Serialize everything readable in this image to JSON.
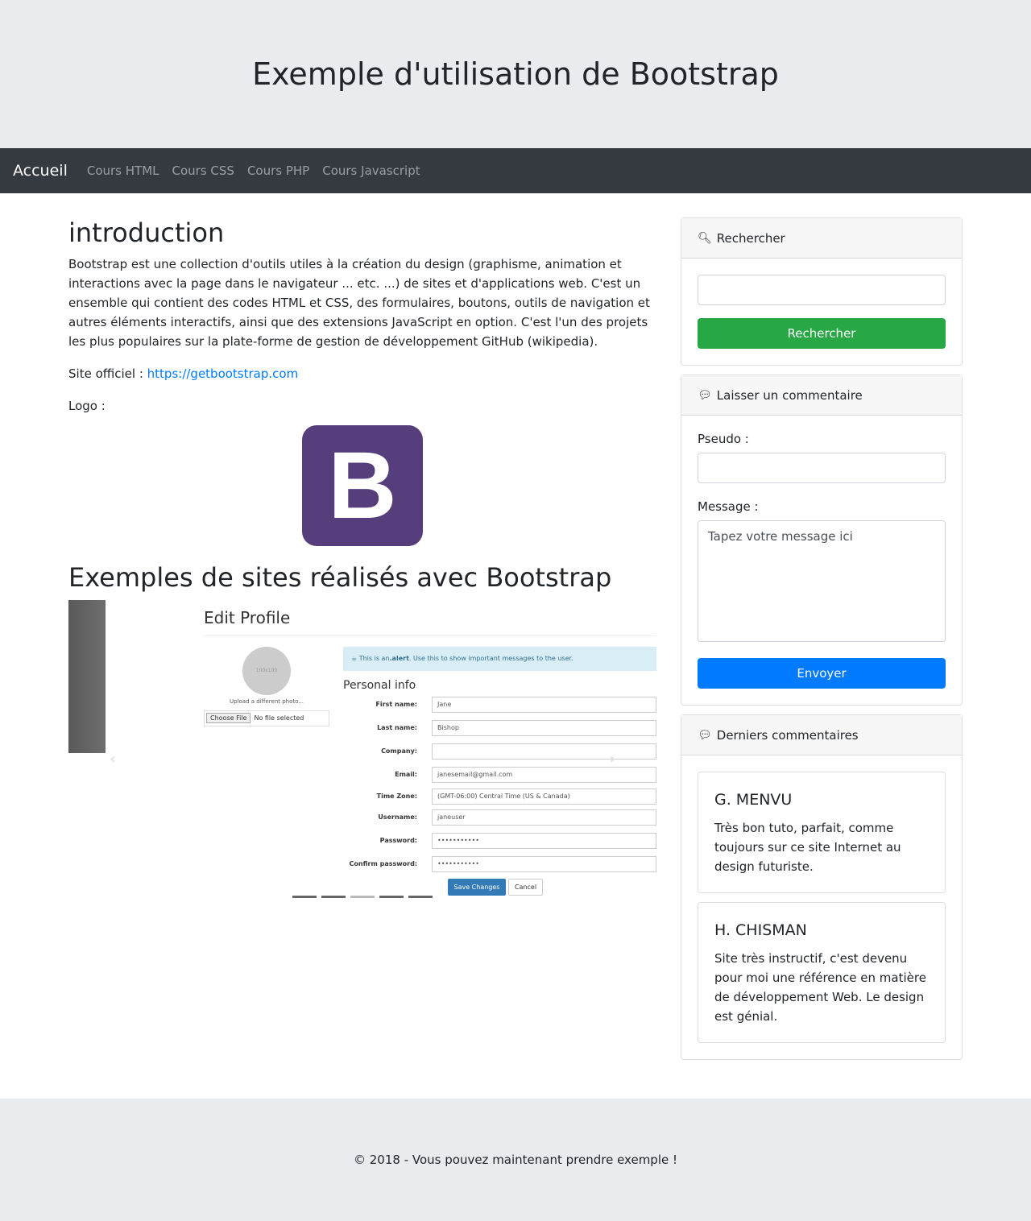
{
  "header": {
    "title": "Exemple d'utilisation de Bootstrap"
  },
  "nav": {
    "brand": "Accueil",
    "links": [
      "Cours HTML",
      "Cours CSS",
      "Cours PHP",
      "Cours Javascript"
    ]
  },
  "main": {
    "intro_title": "introduction",
    "intro_text": "Bootstrap est une collection d'outils utiles à la création du design (graphisme, animation et interactions avec la page dans le navigateur ... etc. ...) de sites et d'applications web. C'est un ensemble qui contient des codes HTML et CSS, des formulaires, boutons, outils de navigation et autres éléments interactifs, ainsi que des extensions JavaScript en option. C'est l'un des projets les plus populaires sur la plate-forme de gestion de développement GitHub (wikipedia).",
    "site_label": "Site officiel : ",
    "site_link": "https://getbootstrap.com",
    "logo_label": "Logo :",
    "logo_letter": "B",
    "examples_title": "Exemples de sites réalisés avec Bootstrap",
    "carousel": {
      "slide": {
        "title": "Edit Profile",
        "avatar_text": "100x100",
        "upload_text": "Upload a different photo...",
        "file_button": "Choose File",
        "file_status": "No file selected",
        "alert_prefix": "This is an ",
        "alert_bold": ".alert",
        "alert_suffix": ". Use this to show important messages to the user.",
        "section": "Personal info",
        "fields": [
          {
            "label": "First name:",
            "value": "Jane"
          },
          {
            "label": "Last name:",
            "value": "Bishop"
          },
          {
            "label": "Company:",
            "value": ""
          },
          {
            "label": "Email:",
            "value": "janesemail@gmail.com"
          },
          {
            "label": "Time Zone:",
            "value": "(GMT-06:00) Central Time (US & Canada)"
          },
          {
            "label": "Username:",
            "value": "janeuser"
          },
          {
            "label": "Password:",
            "value": "•••••••••••"
          },
          {
            "label": "Confirm password:",
            "value": "•••••••••••"
          }
        ],
        "save": "Save Changes",
        "cancel": "Cancel"
      },
      "indicator_count": 5,
      "active_indicator": 2
    }
  },
  "sidebar": {
    "search": {
      "header": "Rechercher",
      "button": "Rechercher",
      "value": ""
    },
    "comment_form": {
      "header": "Laisser un commentaire",
      "pseudo_label": "Pseudo :",
      "message_label": "Message :",
      "message_placeholder": "Tapez votre message ici",
      "button": "Envoyer"
    },
    "latest": {
      "header": "Derniers commentaires",
      "comments": [
        {
          "author": "G. MENVU",
          "text": "Très bon tuto, parfait, comme toujours sur ce site Internet au design futuriste."
        },
        {
          "author": "H. CHISMAN",
          "text": "Site très instructif, c'est devenu pour moi une référence en matière de développement Web. Le design est génial."
        }
      ]
    }
  },
  "footer": {
    "text": "© 2018 - Vous pouvez maintenant prendre exemple !"
  },
  "colors": {
    "navbar": "#343a40",
    "success": "#28a745",
    "primary": "#007bff",
    "logo": "#563d7c",
    "link": "#007bff"
  }
}
